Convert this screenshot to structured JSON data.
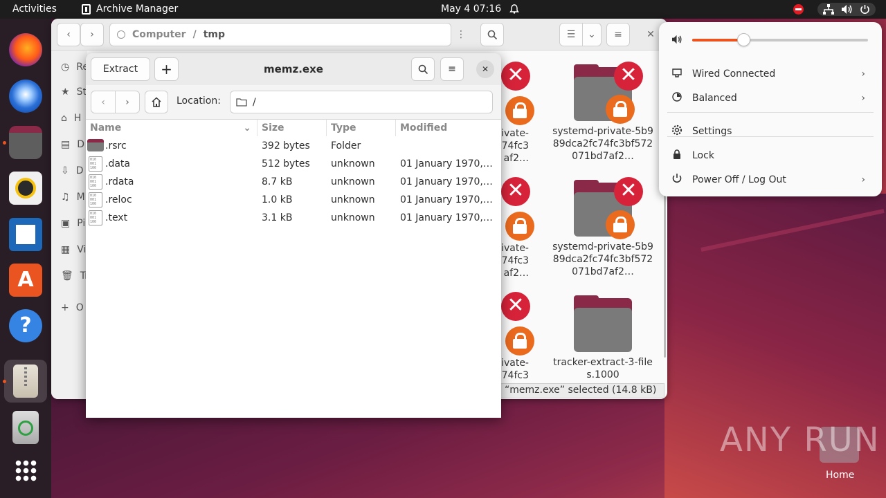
{
  "topbar": {
    "activities": "Activities",
    "app_name": "Archive Manager",
    "clock": "May 4  07:16"
  },
  "files_window": {
    "path": [
      "Computer",
      "tmp"
    ],
    "sidebar_letters": [
      "Re",
      "St",
      "H",
      "D",
      "D",
      "M",
      "Pi",
      "Vi",
      "Tr",
      "O"
    ],
    "items": [
      {
        "label": "systemd-private-5b989dca2fc74fc3bf572071bd7af2…",
        "emblems": true
      },
      {
        "label": "systemd-private-5b989dca2fc74fc3bf572071bd7af2…",
        "emblems": true
      },
      {
        "label": "tracker-extract-3-files.1000",
        "emblems": false
      }
    ],
    "left_partial": [
      {
        "line1": "ivate-",
        "line2": "74fc3",
        "line3": "af2…"
      },
      {
        "line1": "ivate-",
        "line2": "74fc3",
        "line3": "af2…"
      },
      {
        "line1": "ivate-",
        "line2": "74fc3",
        "line3": ""
      }
    ],
    "status": "“memz.exe” selected (14.8 kB)"
  },
  "archive_window": {
    "title": "memz.exe",
    "extract_label": "Extract",
    "location_label": "Location:",
    "location_value": "/",
    "columns": {
      "name": "Name",
      "size": "Size",
      "type": "Type",
      "modified": "Modified"
    },
    "rows": [
      {
        "name": ".rsrc",
        "size": "392 bytes",
        "type": "Folder",
        "modified": "",
        "icon": "folder"
      },
      {
        "name": ".data",
        "size": "512 bytes",
        "type": "unknown",
        "modified": "01 January 1970,…",
        "icon": "binary"
      },
      {
        "name": ".rdata",
        "size": "8.7 kB",
        "type": "unknown",
        "modified": "01 January 1970,…",
        "icon": "binary"
      },
      {
        "name": ".reloc",
        "size": "1.0 kB",
        "type": "unknown",
        "modified": "01 January 1970,…",
        "icon": "binary"
      },
      {
        "name": ".text",
        "size": "3.1 kB",
        "type": "unknown",
        "modified": "01 January 1970,…",
        "icon": "binary"
      }
    ]
  },
  "system_menu": {
    "volume_level": 0.29,
    "items": [
      {
        "label": "Wired Connected",
        "icon": "network-icon",
        "chevron": true
      },
      {
        "label": "Balanced",
        "icon": "power-mode-icon",
        "chevron": true
      },
      {
        "label": "Settings",
        "icon": "gear-icon",
        "chevron": false
      },
      {
        "label": "Lock",
        "icon": "lock-icon",
        "chevron": false
      },
      {
        "label": "Power Off / Log Out",
        "icon": "power-icon",
        "chevron": true
      }
    ]
  },
  "desktop": {
    "watermark": "ANY RUN",
    "home_label": "Home"
  },
  "colors": {
    "accent": "#e95420",
    "danger": "#d7233a",
    "topbar": "#1d1d1d"
  }
}
